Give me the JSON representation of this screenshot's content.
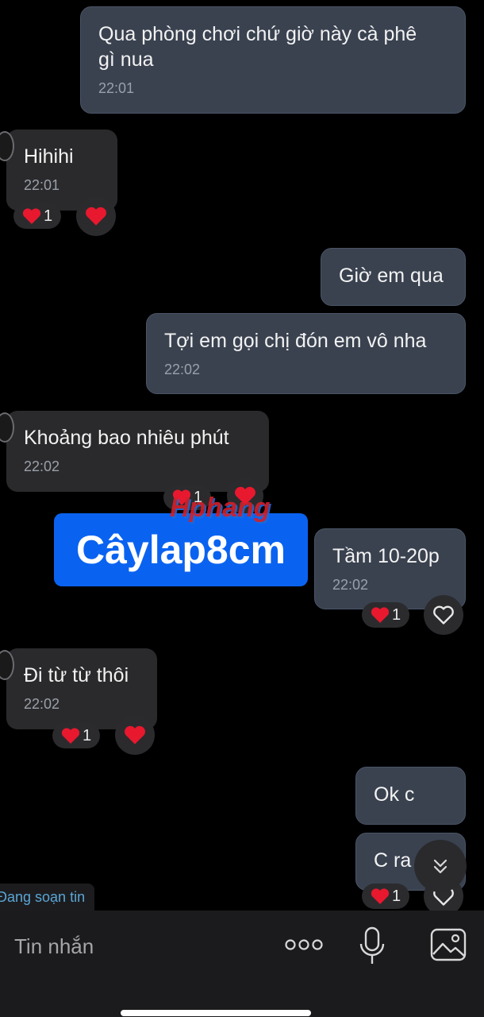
{
  "messages": {
    "m1": {
      "text": "Qua phòng chơi chứ giờ này cà phê\ngì nua",
      "time": "22:01"
    },
    "m2": {
      "text": "Hihihi",
      "time": "22:01",
      "reaction_count": "1"
    },
    "m3": {
      "text": "Giờ em qua"
    },
    "m4": {
      "text": "Tợi em gọi chị đón em vô nha",
      "time": "22:02"
    },
    "m5": {
      "text": "Khoảng bao nhiêu phút",
      "time": "22:02",
      "reaction_count": "1"
    },
    "m6": {
      "text": "Tầm 10-20p",
      "time": "22:02",
      "reaction_count": "1"
    },
    "m7": {
      "text": "Đi từ từ thôi",
      "time": "22:02",
      "reaction_count": "1"
    },
    "m8": {
      "text": "Ok c"
    },
    "m9": {
      "text": "C ra",
      "reaction_count": "1"
    }
  },
  "watermark": {
    "text": "Câylap8cm",
    "brand": "Hphang"
  },
  "typing_indicator": "Đang soạn tin",
  "composer": {
    "placeholder": "Tin nhắn"
  },
  "icons": [
    "heart-reaction-icon",
    "heart-outline-icon",
    "more-dots-icon",
    "microphone-icon",
    "image-icon",
    "scroll-down-icon"
  ],
  "colors": {
    "background": "#000000",
    "my_bubble": "#3a4250",
    "their_bubble": "#2a2a2c",
    "watermark_box": "#0a63f0",
    "typing_text": "#5aa6d6"
  }
}
